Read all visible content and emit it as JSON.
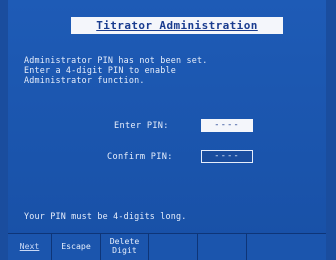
{
  "title": "Titrator Administration",
  "message_lines": "Administrator PIN has not been set.\nEnter a 4-digit PIN to enable\nAdministrator function.",
  "enter_label": "Enter PIN:",
  "enter_value": "----",
  "confirm_label": "Confirm PIN:",
  "confirm_value": "----",
  "note": "Your PIN must be 4-digits long.",
  "softkeys": {
    "next": "Next",
    "escape": "Escape",
    "delete_line1": "Delete",
    "delete_line2": "Digit"
  }
}
